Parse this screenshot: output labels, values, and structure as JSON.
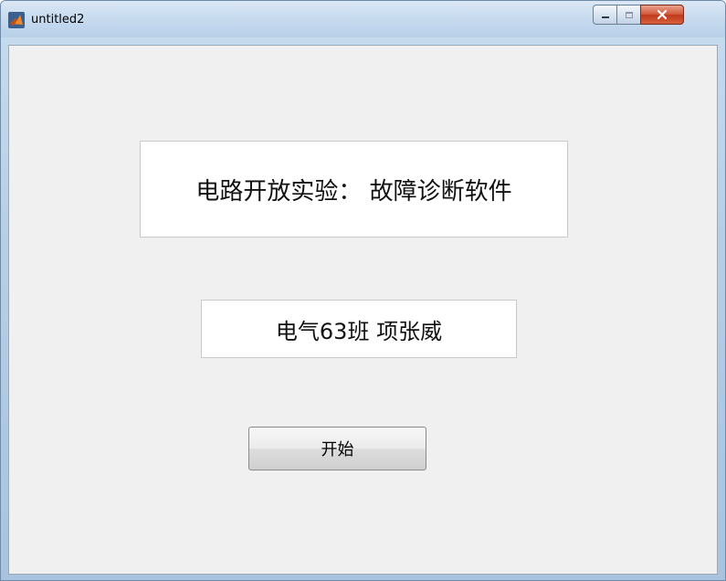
{
  "window": {
    "title": "untitled2",
    "app_icon": "matlab-icon",
    "controls": {
      "minimize": "minimize-icon",
      "maximize": "maximize-icon",
      "close": "close-icon"
    }
  },
  "main": {
    "title_text": "电路开放实验： 故障诊断软件",
    "author_text": "电气63班  项张威",
    "start_button_label": "开始"
  },
  "colors": {
    "client_background": "#f0f0f0",
    "textbox_background": "#ffffff",
    "close_button": "#c7432a"
  }
}
